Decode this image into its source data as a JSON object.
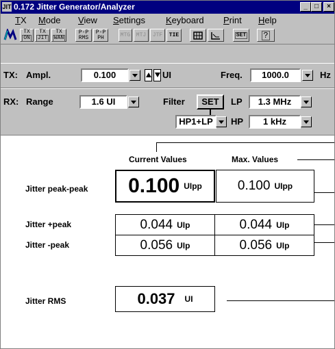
{
  "window": {
    "app_icon_text": "JIT",
    "title": "0.172 Jitter Generator/Analyzer",
    "controls": [
      "_",
      "□",
      "×"
    ]
  },
  "menu": {
    "items": [
      {
        "label": "TX",
        "underline": "T"
      },
      {
        "label": "Mode",
        "underline": "M"
      },
      {
        "label": "View",
        "underline": "V"
      },
      {
        "label": "Settings",
        "underline": "S"
      },
      {
        "label": "Keyboard",
        "underline": "K"
      },
      {
        "label": "Print",
        "underline": "P"
      },
      {
        "label": "Help",
        "underline": "H"
      }
    ]
  },
  "toolbar": {
    "buttons": [
      {
        "top": "TX",
        "bottom": "ON",
        "enabled": true
      },
      {
        "top": "TX",
        "bottom": "JIT",
        "enabled": true
      },
      {
        "top": "TX",
        "bottom": "WAN",
        "enabled": true
      },
      {
        "top": "P-P",
        "bottom": "RMS",
        "enabled": true
      },
      {
        "top": "P-P",
        "bottom": "PH",
        "enabled": true
      },
      {
        "top": "",
        "bottom": "MTG",
        "enabled": false
      },
      {
        "top": "",
        "bottom": "MTJ",
        "enabled": false
      },
      {
        "top": "",
        "bottom": "JTF",
        "enabled": false
      },
      {
        "top": "",
        "bottom": "TIE",
        "enabled": true
      },
      {
        "top": "",
        "bottom": "SET",
        "enabled": true
      },
      {
        "top": "",
        "bottom": "?",
        "enabled": true
      }
    ]
  },
  "tx": {
    "label": "TX:",
    "ampl_label": "Ampl.",
    "ampl_value": "0.100",
    "ampl_unit": "UI",
    "freq_label": "Freq.",
    "freq_value": "1000.0",
    "freq_unit": "Hz"
  },
  "rx": {
    "label": "RX:",
    "range_label": "Range",
    "range_value": "1.6 UI",
    "filter_label": "Filter",
    "filter_set_label": "SET",
    "lp_label": "LP",
    "lp_value": "1.3 MHz",
    "filter_mode_value": "HP1+LP",
    "hp_label": "HP",
    "hp_value": "1 kHz"
  },
  "results": {
    "col_current": "Current Values",
    "col_max": "Max. Values",
    "rows": [
      {
        "label": "Jitter peak-peak",
        "current": "0.100",
        "current_unit": "UIpp",
        "max": "0.100",
        "max_unit": "UIpp"
      },
      {
        "label": "Jitter +peak",
        "current": "0.044",
        "current_unit": "UIp",
        "max": "0.044",
        "max_unit": "UIp"
      },
      {
        "label": "Jitter -peak",
        "current": "0.056",
        "current_unit": "UIp",
        "max": "0.056",
        "max_unit": "UIp"
      }
    ],
    "rms": {
      "label": "Jitter RMS",
      "value": "0.037",
      "unit": "UI"
    }
  }
}
